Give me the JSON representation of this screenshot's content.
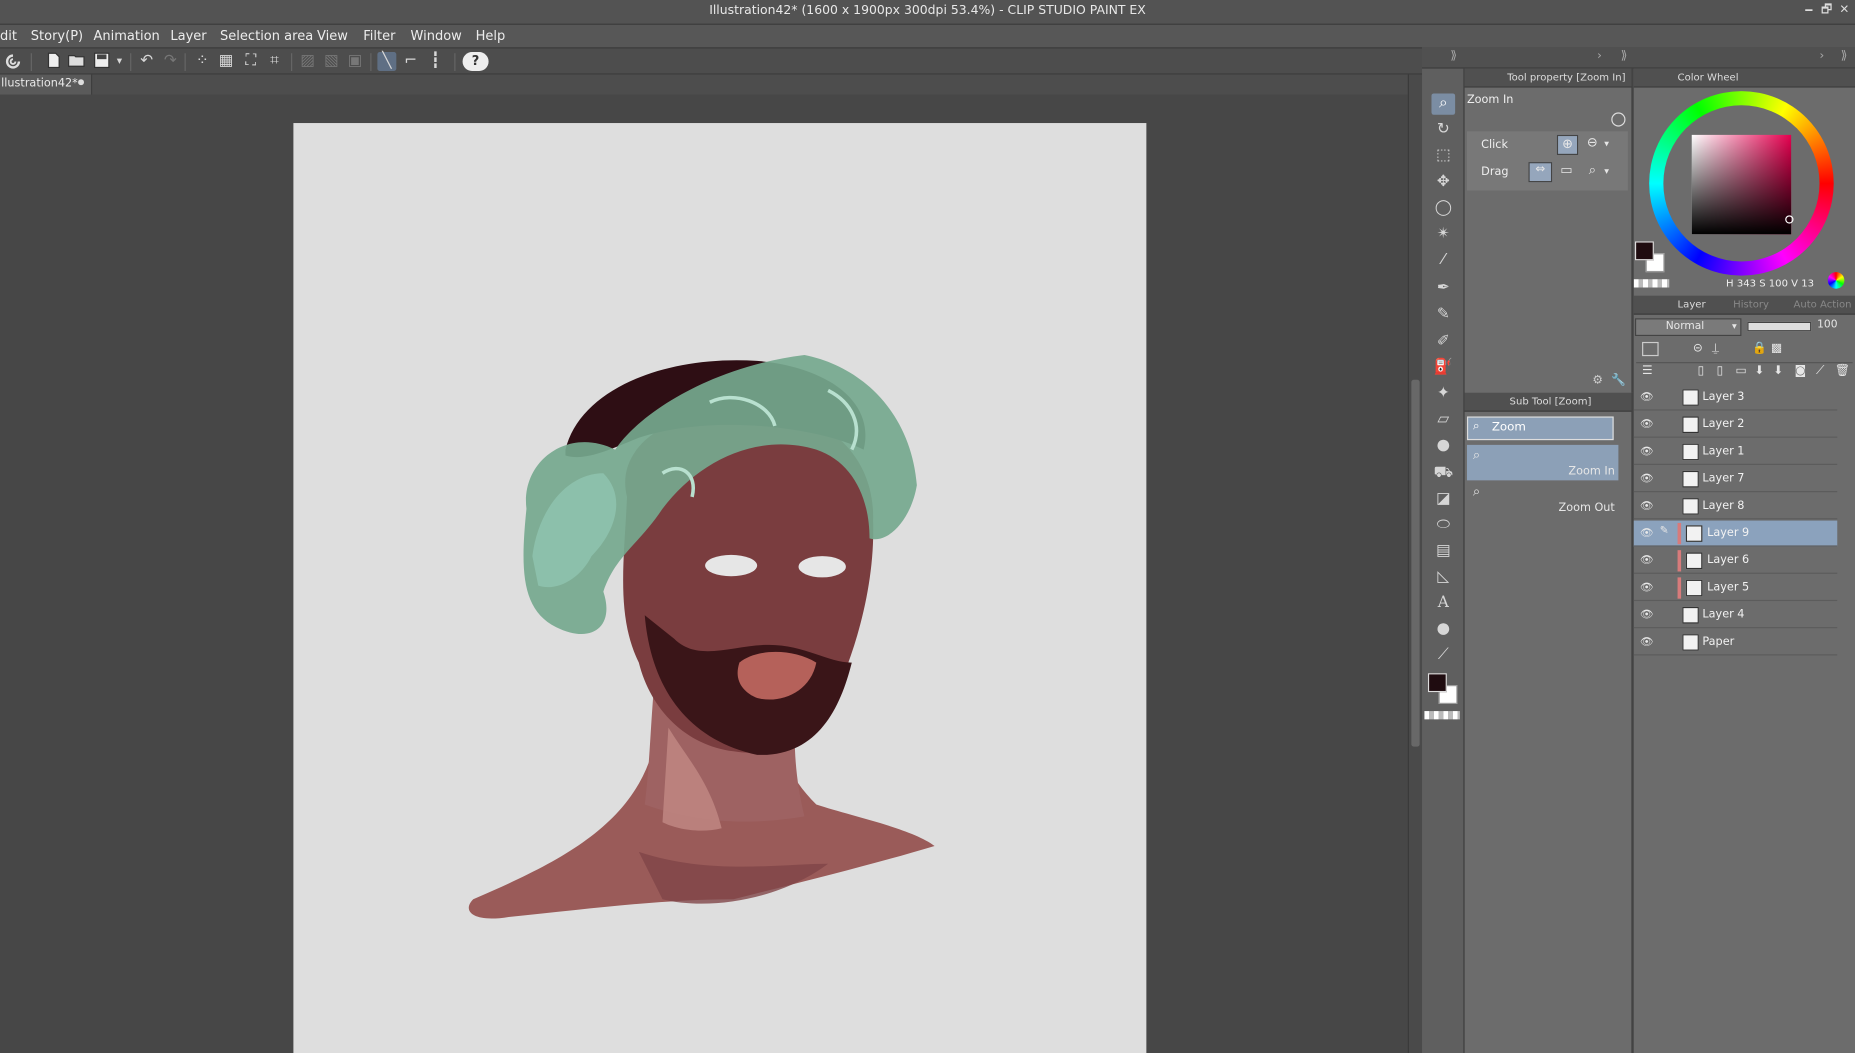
{
  "window": {
    "title": "Illustration42* (1600 x 1900px 300dpi 53.4%)  - CLIP STUDIO PAINT EX",
    "controls": [
      "🗕",
      "🗗",
      "✕"
    ]
  },
  "menu": [
    "dit",
    "Story(P)",
    "Animation",
    "Layer",
    "Selection area",
    "View",
    "Filter",
    "Window",
    "Help"
  ],
  "document_tab": {
    "label": "llustration42*"
  },
  "toolbar_icons": [
    "clip-studio-icon",
    "new-icon",
    "open-icon",
    "save-icon",
    "undo-icon",
    "redo-icon",
    "transform-icon",
    "fit-icon",
    "fill-icon",
    "crop-icon",
    "clear-icon",
    "eraser-icon",
    "select-icon",
    "snap-ruler-icon",
    "snap-special-icon",
    "snap-grid-icon",
    "help-icon"
  ],
  "tool_property": {
    "tab": "Tool property [Zoom In]",
    "tool_name": "Zoom In",
    "rows": [
      {
        "label": "Click"
      },
      {
        "label": "Drag"
      }
    ]
  },
  "sub_tool": {
    "tab": "Sub Tool [Zoom]",
    "group": "Zoom",
    "items": [
      {
        "label": "Zoom In",
        "selected": true
      },
      {
        "label": "Zoom Out",
        "selected": false
      }
    ]
  },
  "color_wheel": {
    "tab": "Color Wheel",
    "hsv_label": "H 343 S 100 V  13",
    "main_color": "#1f0c10",
    "sub_color": "#ffffff"
  },
  "layer_panel": {
    "tabs": [
      "Layer",
      "History",
      "Auto Action"
    ],
    "blend_mode": "Normal",
    "opacity": "100",
    "layers": [
      {
        "name": "Layer 3",
        "selected": false,
        "color_mark": false
      },
      {
        "name": "Layer 2",
        "selected": false,
        "color_mark": false
      },
      {
        "name": "Layer 1",
        "selected": false,
        "color_mark": false
      },
      {
        "name": "Layer 7",
        "selected": false,
        "color_mark": false
      },
      {
        "name": "Layer 8",
        "selected": false,
        "color_mark": false
      },
      {
        "name": "Layer 9",
        "selected": true,
        "color_mark": true
      },
      {
        "name": "Layer 6",
        "selected": false,
        "color_mark": true
      },
      {
        "name": "Layer 5",
        "selected": false,
        "color_mark": true
      },
      {
        "name": "Layer 4",
        "selected": false,
        "color_mark": false
      },
      {
        "name": "Paper",
        "selected": false,
        "color_mark": false
      }
    ]
  },
  "colors": {
    "accent": "#7b8da3",
    "selected_layer": "#8ba2bd",
    "paper": "#dedede"
  }
}
